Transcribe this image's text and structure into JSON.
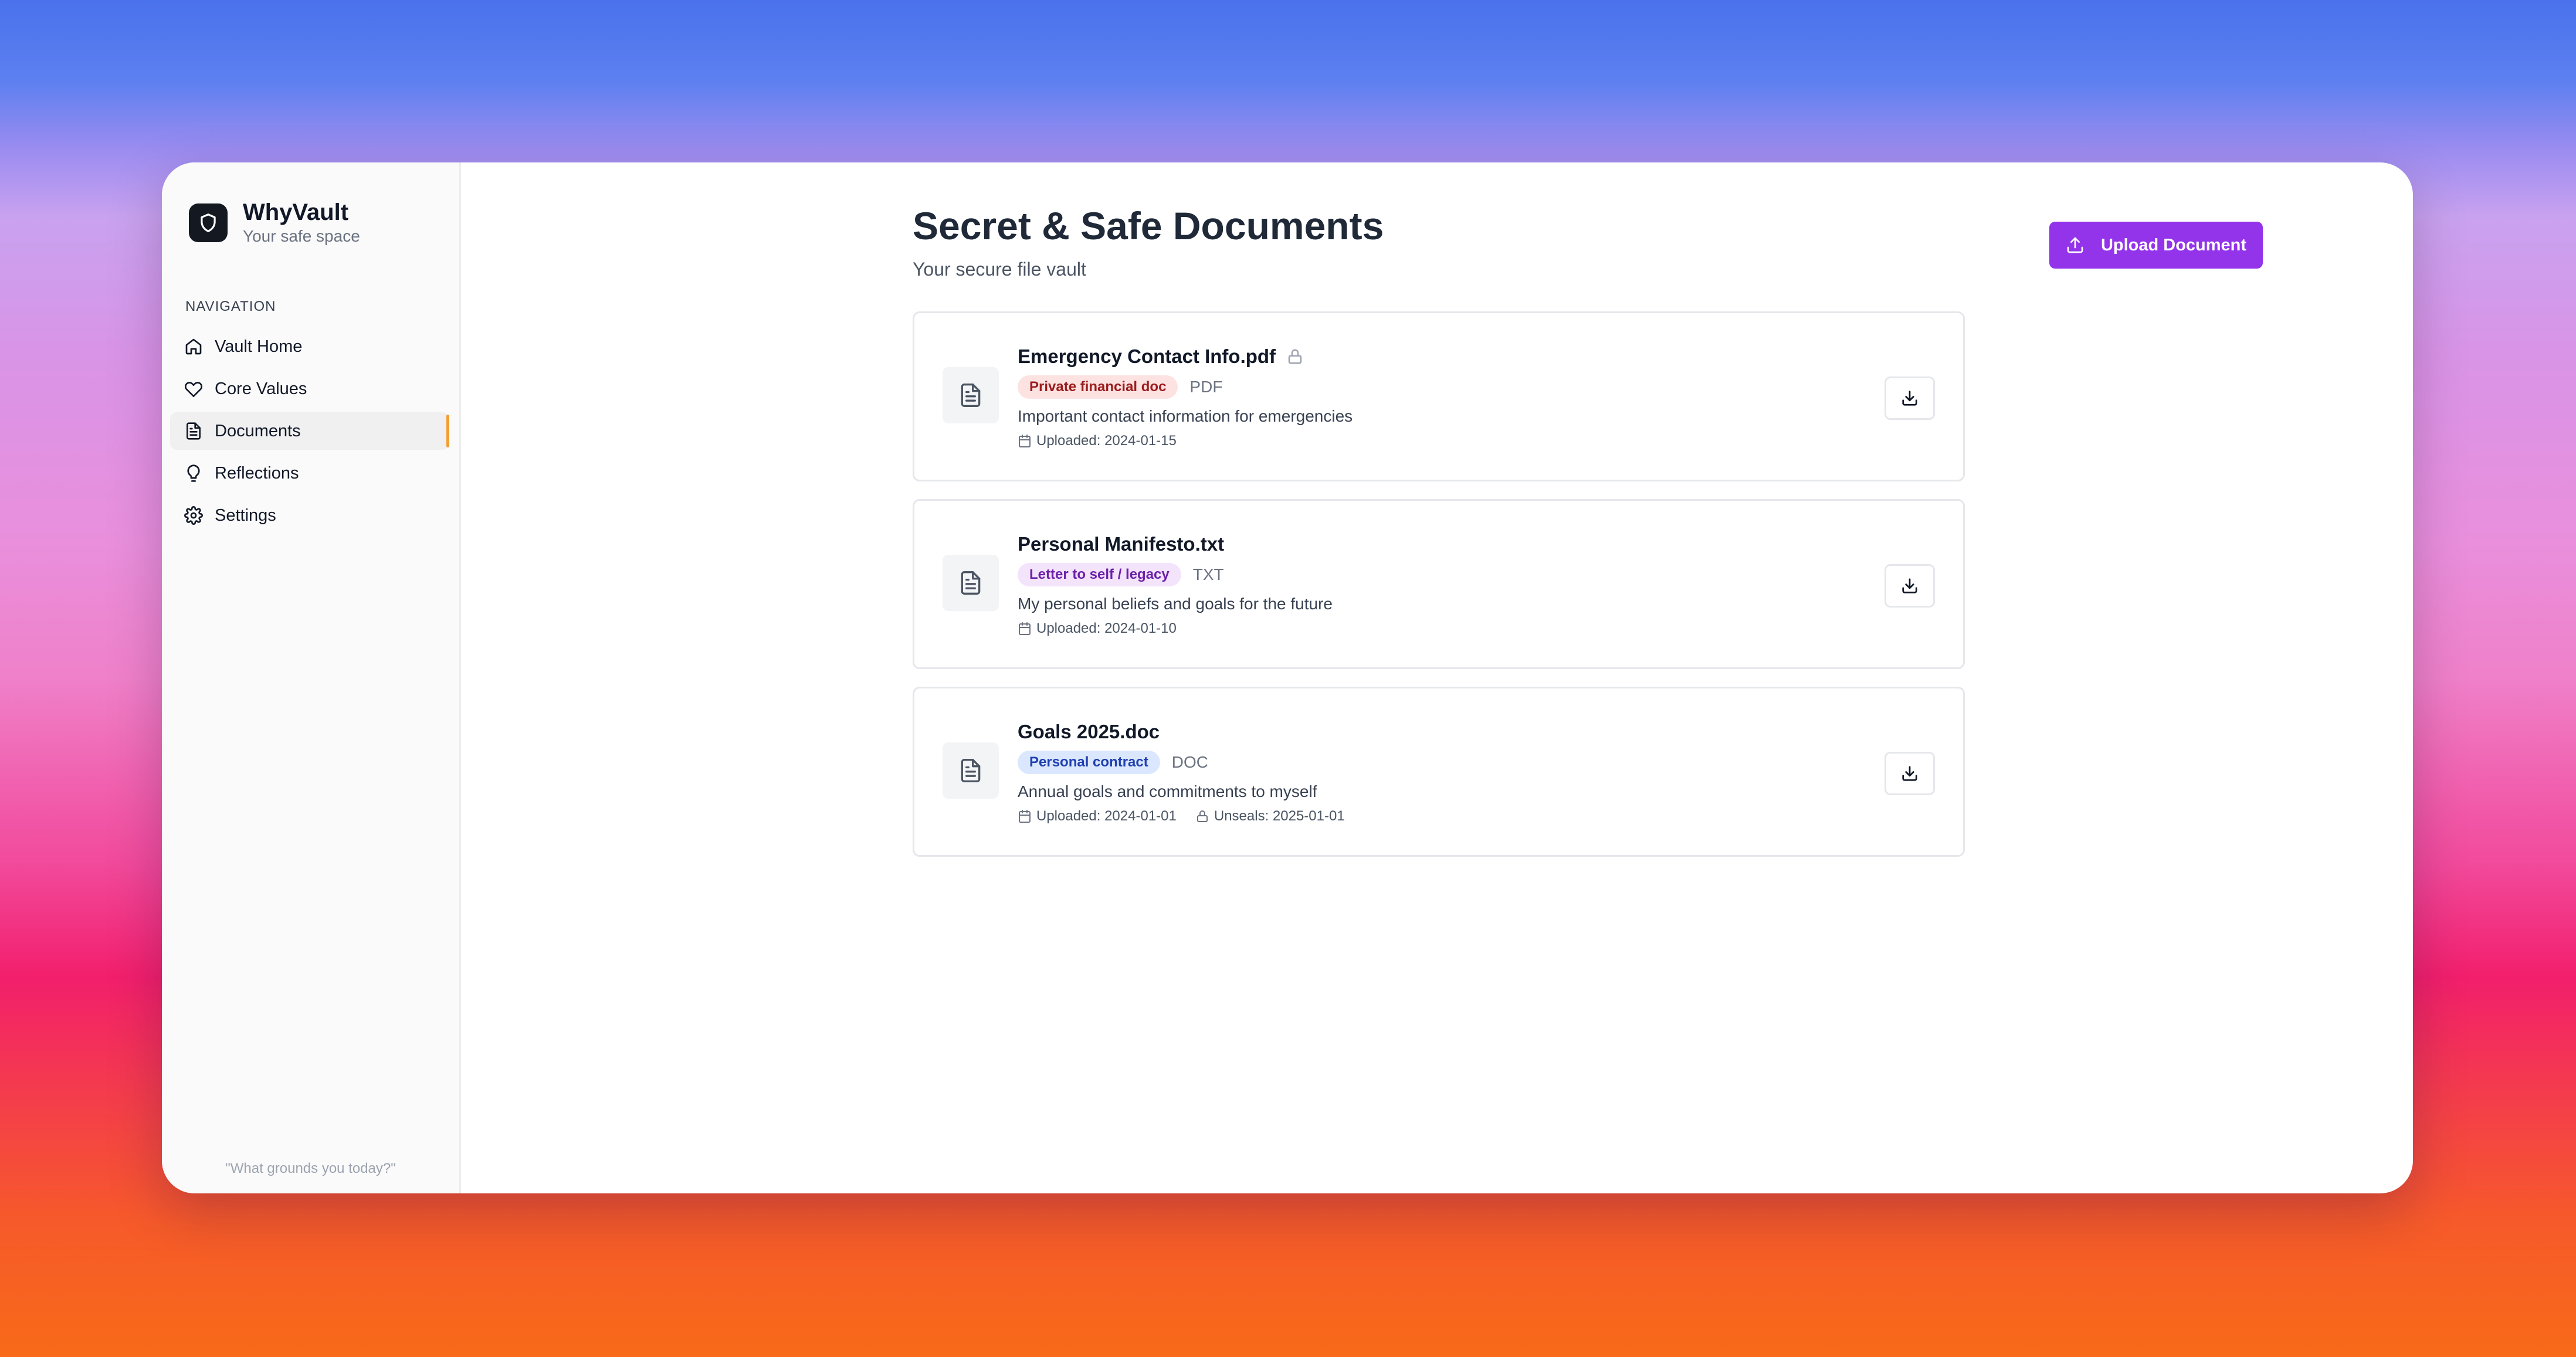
{
  "app": {
    "name": "WhyVault",
    "tagline": "Your safe space"
  },
  "sidebar": {
    "heading": "NAVIGATION",
    "items": [
      {
        "label": "Vault Home",
        "icon": "home-icon"
      },
      {
        "label": "Core Values",
        "icon": "heart-icon"
      },
      {
        "label": "Documents",
        "icon": "document-icon",
        "active": true
      },
      {
        "label": "Reflections",
        "icon": "lightbulb-icon"
      },
      {
        "label": "Settings",
        "icon": "gear-icon"
      }
    ],
    "quote": "\"What grounds you today?\""
  },
  "main": {
    "title": "Secret & Safe Documents",
    "subtitle": "Your secure file vault",
    "upload_label": "Upload Document",
    "documents": [
      {
        "name": "Emergency Contact Info.pdf",
        "locked": true,
        "tag": "Private financial doc",
        "tag_color": "#fde2e2",
        "tag_text_color": "#9b1c1c",
        "type": "PDF",
        "description": "Important contact information for emergencies",
        "uploaded": "Uploaded: 2024-01-15"
      },
      {
        "name": "Personal Manifesto.txt",
        "locked": false,
        "tag": "Letter to self / legacy",
        "tag_color": "#f3e3fb",
        "tag_text_color": "#6b21a8",
        "type": "TXT",
        "description": "My personal beliefs and goals for the future",
        "uploaded": "Uploaded: 2024-01-10"
      },
      {
        "name": "Goals 2025.doc",
        "locked": false,
        "tag": "Personal contract",
        "tag_color": "#dbe7fe",
        "tag_text_color": "#1e40af",
        "type": "DOC",
        "description": "Annual goals and commitments to myself",
        "uploaded": "Uploaded: 2024-01-01",
        "unseals": "Unseals: 2025-01-01"
      }
    ]
  },
  "colors": {
    "accent": "#9333ea",
    "active_indicator": "#f59e2f"
  }
}
